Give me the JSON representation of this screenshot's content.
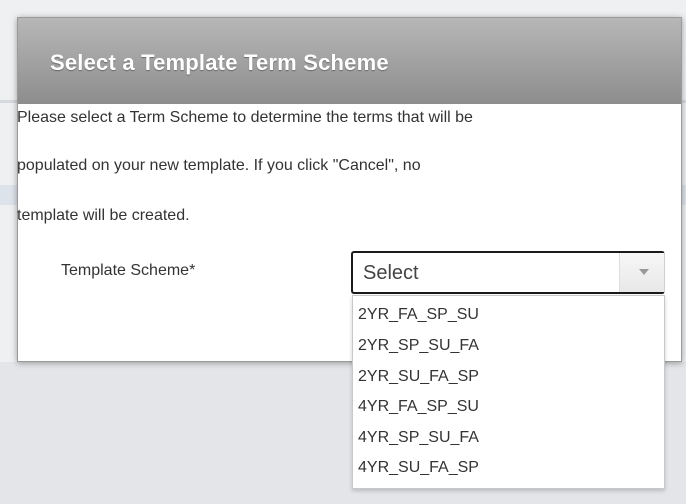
{
  "dialog": {
    "title": "Select a Template Term Scheme",
    "description_lines": [
      "Please select a Term Scheme to determine the terms that will be",
      "populated on your new template. If you click \"Cancel\", no",
      "template will be created."
    ]
  },
  "form": {
    "field_label": "Template Scheme*",
    "select_value": "Select",
    "options": [
      "2YR_FA_SP_SU",
      "2YR_SP_SU_FA",
      "2YR_SU_FA_SP",
      "4YR_FA_SP_SU",
      "4YR_SP_SU_FA",
      "4YR_SU_FA_SP"
    ]
  },
  "icons": {
    "select_arrow": "chevron-down-icon"
  },
  "colors": {
    "header_gradient_top": "#b7b7b7",
    "header_gradient_bottom": "#8d8d8d",
    "text": "#333333"
  }
}
